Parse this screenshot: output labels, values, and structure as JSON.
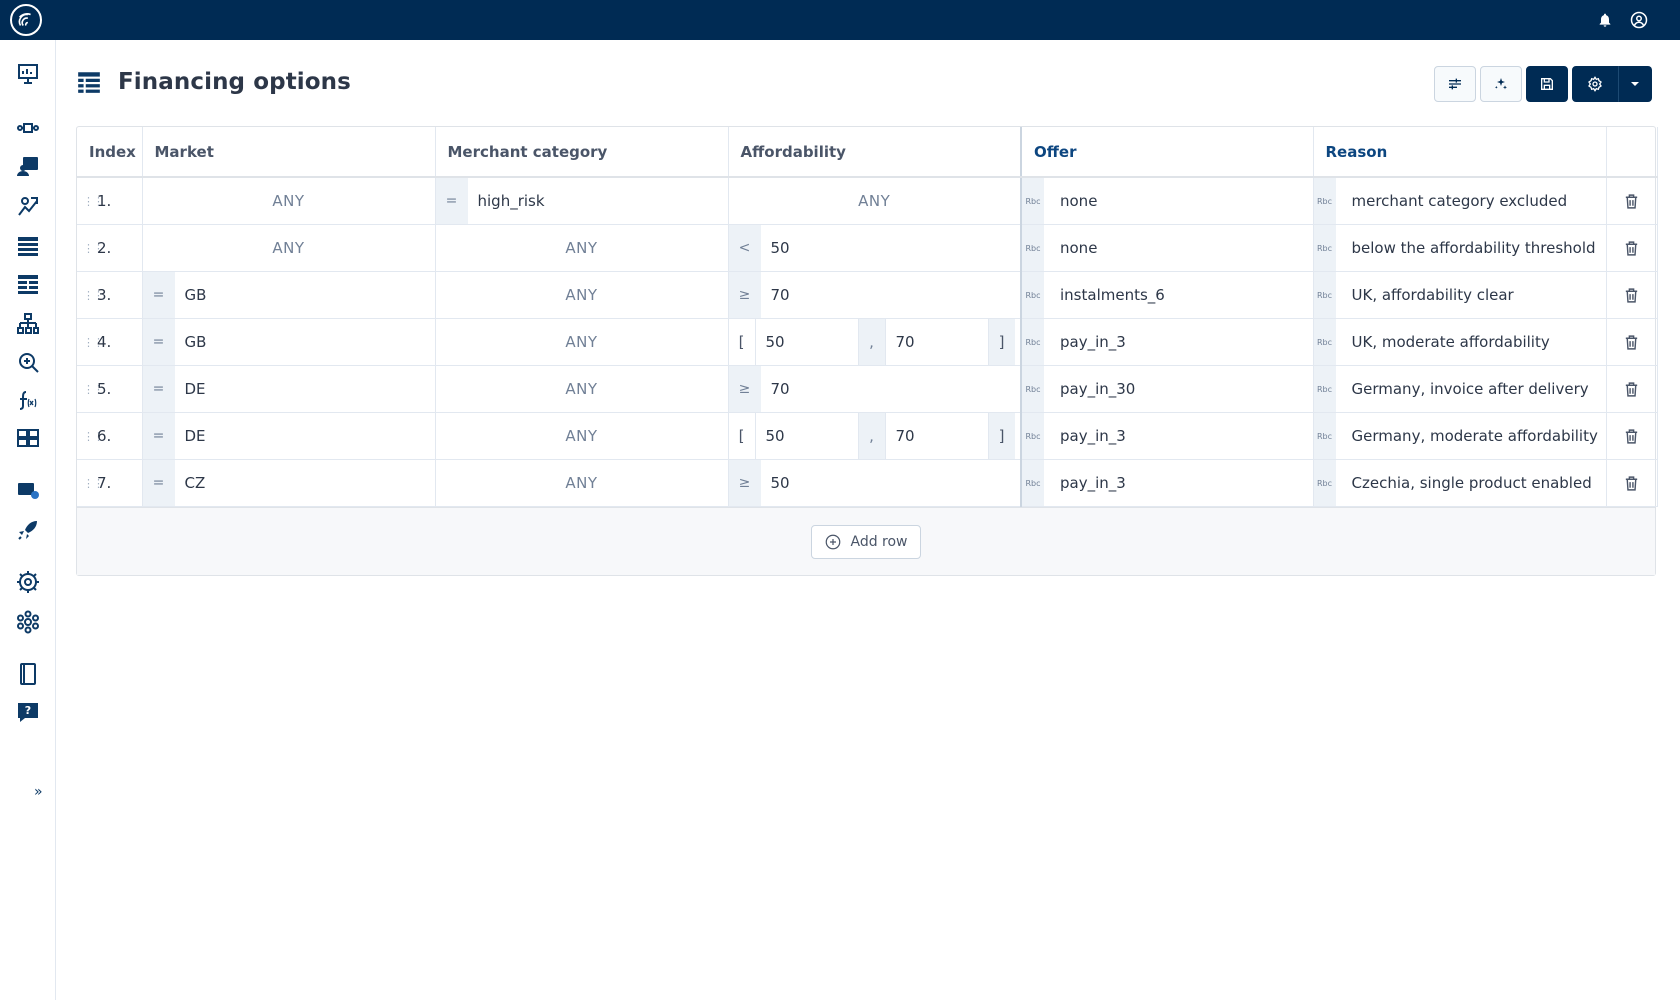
{
  "page": {
    "title": "Financing options"
  },
  "table": {
    "headers": {
      "index": "Index",
      "market": "Market",
      "merchant_category": "Merchant category",
      "affordability": "Affordability",
      "offer": "Offer",
      "reason": "Reason"
    },
    "any_label": "ANY",
    "string_type_label": "Rbc",
    "rows": [
      {
        "index": "1.",
        "market": {
          "op": "",
          "value": "ANY"
        },
        "category": {
          "op": "=",
          "value": "high_risk"
        },
        "afford": {
          "kind": "any",
          "value": "ANY"
        },
        "offer": "none",
        "reason": "merchant category excluded"
      },
      {
        "index": "2.",
        "market": {
          "op": "",
          "value": "ANY"
        },
        "category": {
          "op": "",
          "value": "ANY"
        },
        "afford": {
          "kind": "cmp",
          "op": "<",
          "value": "50"
        },
        "offer": "none",
        "reason": "below the affordability threshold"
      },
      {
        "index": "3.",
        "market": {
          "op": "=",
          "value": "GB"
        },
        "category": {
          "op": "",
          "value": "ANY"
        },
        "afford": {
          "kind": "cmp",
          "op": "≥",
          "value": "70"
        },
        "offer": "instalments_6",
        "reason": "UK, affordability clear"
      },
      {
        "index": "4.",
        "market": {
          "op": "=",
          "value": "GB"
        },
        "category": {
          "op": "",
          "value": "ANY"
        },
        "afford": {
          "kind": "range",
          "open": "[",
          "from": "50",
          "sep": ",",
          "to": "70",
          "close": "]"
        },
        "offer": "pay_in_3",
        "reason": "UK, moderate affordability"
      },
      {
        "index": "5.",
        "market": {
          "op": "=",
          "value": "DE"
        },
        "category": {
          "op": "",
          "value": "ANY"
        },
        "afford": {
          "kind": "cmp",
          "op": "≥",
          "value": "70"
        },
        "offer": "pay_in_30",
        "reason": "Germany, invoice after delivery"
      },
      {
        "index": "6.",
        "market": {
          "op": "=",
          "value": "DE"
        },
        "category": {
          "op": "",
          "value": "ANY"
        },
        "afford": {
          "kind": "range",
          "open": "[",
          "from": "50",
          "sep": ",",
          "to": "70",
          "close": "]"
        },
        "offer": "pay_in_3",
        "reason": "Germany, moderate affordability"
      },
      {
        "index": "7.",
        "market": {
          "op": "=",
          "value": "CZ"
        },
        "category": {
          "op": "",
          "value": "ANY"
        },
        "afford": {
          "kind": "cmp",
          "op": "≥",
          "value": "50"
        },
        "offer": "pay_in_3",
        "reason": "Czechia, single product enabled"
      }
    ],
    "add_row_label": "Add row"
  },
  "sidebar": {
    "icons": [
      "dashboard-icon",
      "workflow-icon",
      "contacts-icon",
      "decision-tree-icon",
      "decision-table-icon",
      "decision-table-alt-icon",
      "hierarchy-icon",
      "search-analytics-icon",
      "function-icon",
      "data-grid-icon",
      "release-icon",
      "deploy-icon",
      "settings-gear-icon",
      "integrations-icon",
      "docs-icon",
      "help-icon"
    ],
    "expand_label": "»"
  },
  "colors": {
    "topbar": "#002b54",
    "accent": "#0d4680"
  }
}
